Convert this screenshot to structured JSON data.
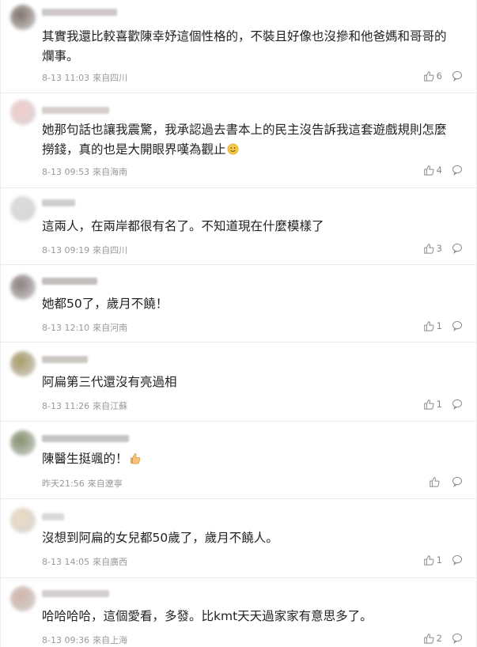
{
  "comments": [
    {
      "text": "其實我還比較喜歡陳幸妤這個性格的，不裝且好像也沒摻和他爸媽和哥哥的爛事。",
      "time": "8-13 11:03",
      "location": "來自四川",
      "likes": "6",
      "avatar_color": "#6b5a52",
      "name_color": "#b8b0b5"
    },
    {
      "text": "她那句話也讓我震驚，我承認過去書本上的民主沒告訴我這套遊戲規則怎麼撈錢，真的也是大開眼界嘆為觀止",
      "emoji": "smile-emoji-icon",
      "time": "8-13 09:53",
      "location": "來自海南",
      "likes": "4",
      "avatar_color": "#f2c4c4",
      "name_color": "#c7b9b9"
    },
    {
      "text": "這兩人，在兩岸都很有名了。不知道現在什麼模樣了",
      "time": "8-13 09:19",
      "location": "來自四川",
      "likes": "3",
      "avatar_color": "#d6d6d6",
      "name_color": "#b9b9b9"
    },
    {
      "text": "她都50了，歲月不饒！",
      "time": "8-13 12:10",
      "location": "來自河南",
      "likes": "1",
      "avatar_color": "#7a6a6a",
      "name_color": "#a9a3a3"
    },
    {
      "text": "阿扁第三代還沒有亮過相",
      "time": "8-13 11:26",
      "location": "來自江蘇",
      "likes": "1",
      "avatar_color": "#9b8a4c",
      "name_color": "#b5b0a8"
    },
    {
      "text": "陳醫生挺颯的！",
      "emoji": "thumbs-up-emoji-icon",
      "time": "昨天21:56",
      "location": "來自遼寧",
      "likes": "",
      "avatar_color": "#6f7f55",
      "name_color": "#adadad"
    },
    {
      "text": "沒想到阿扁的女兒都50歲了，歲月不饒人。",
      "time": "8-13 14:05",
      "location": "來自廣西",
      "likes": "1",
      "avatar_color": "#e8d5b8",
      "name_color": "#c9c9c9"
    },
    {
      "text": "哈哈哈哈，這個愛看，多發。比kmt天天過家家有意思多了。",
      "time": "8-13 09:36",
      "location": "來自上海",
      "likes": "2",
      "avatar_color": "#c9a89a",
      "name_color": "#c1b8b8"
    }
  ],
  "icons": {
    "like": "thumbs-up-icon",
    "reply": "comment-bubble-icon"
  }
}
